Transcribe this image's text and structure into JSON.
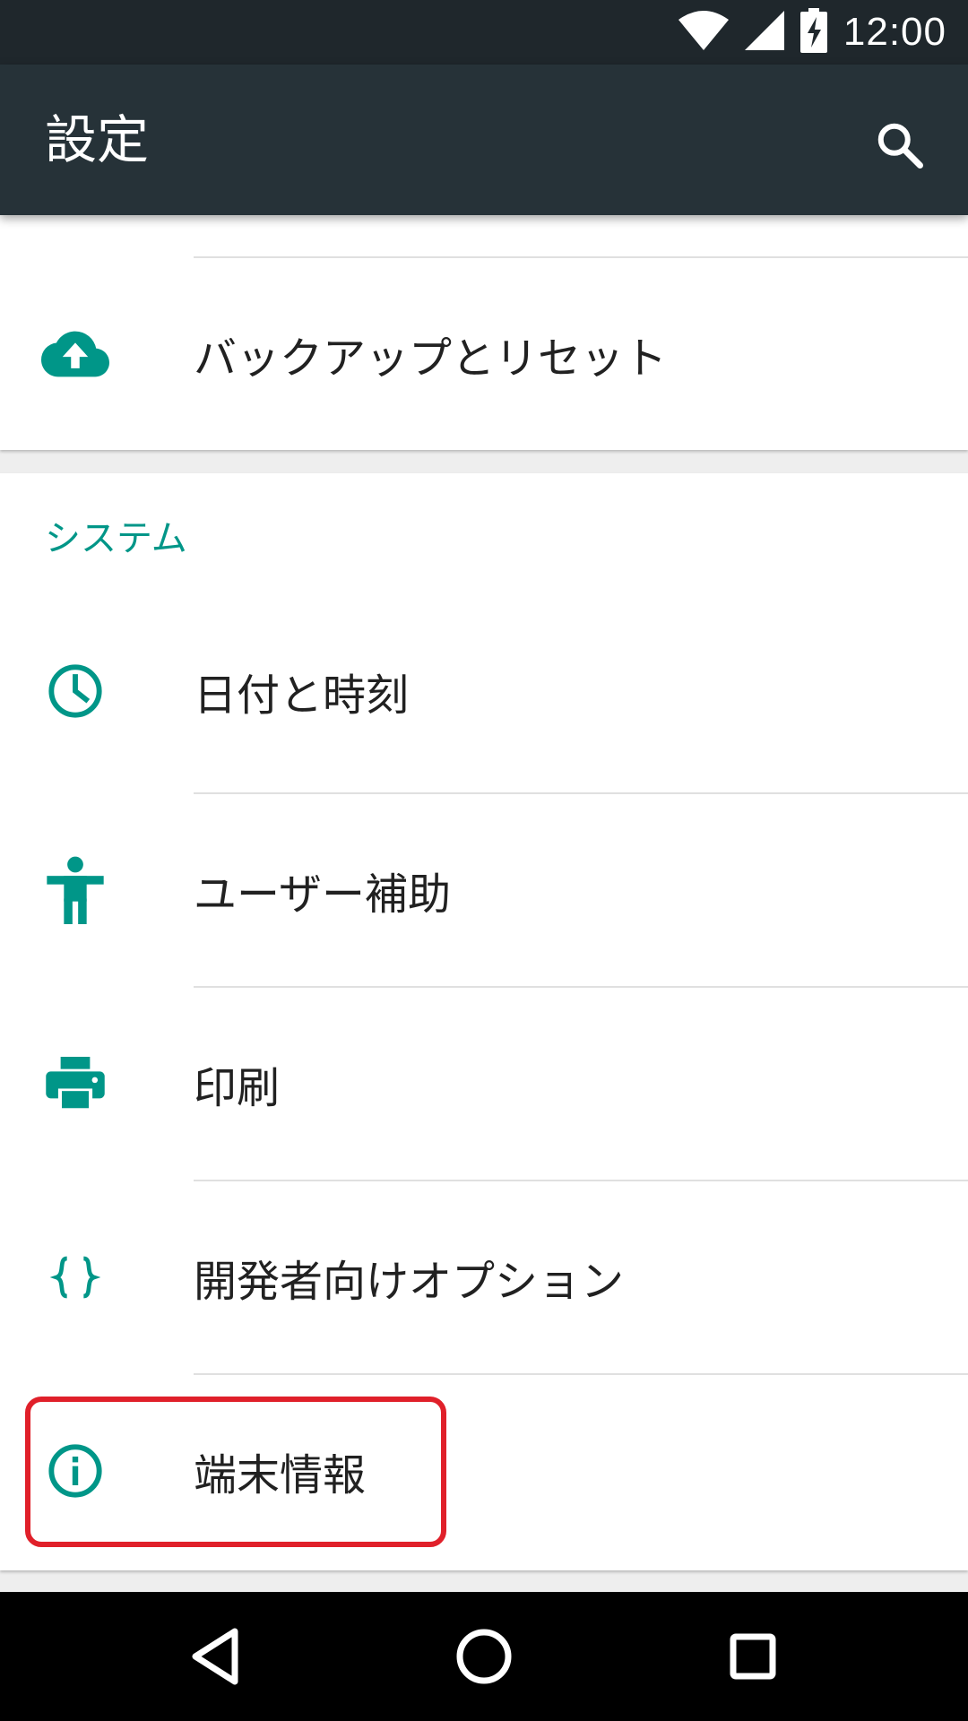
{
  "status_bar": {
    "time": "12:00",
    "icons": [
      "wifi-icon",
      "cell-signal-icon",
      "battery-charging-icon"
    ]
  },
  "app_bar": {
    "title": "設定",
    "search_icon": "search-icon"
  },
  "top_section": {
    "items": [
      {
        "label": "バックアップとリセット",
        "icon": "cloud-upload-icon"
      }
    ]
  },
  "system_section": {
    "header": "システム",
    "items": [
      {
        "label": "日付と時刻",
        "icon": "clock-icon"
      },
      {
        "label": "ユーザー補助",
        "icon": "accessibility-icon"
      },
      {
        "label": "印刷",
        "icon": "printer-icon"
      },
      {
        "label": "開発者向けオプション",
        "icon": "braces-icon"
      },
      {
        "label": "端末情報",
        "icon": "info-icon"
      }
    ]
  },
  "navigation": {
    "buttons": [
      "back-icon",
      "home-icon",
      "recents-icon"
    ]
  },
  "colors": {
    "accent": "#009688",
    "app_bar": "#263238",
    "status_bar": "#1f272c",
    "highlight": "#e0202a"
  }
}
